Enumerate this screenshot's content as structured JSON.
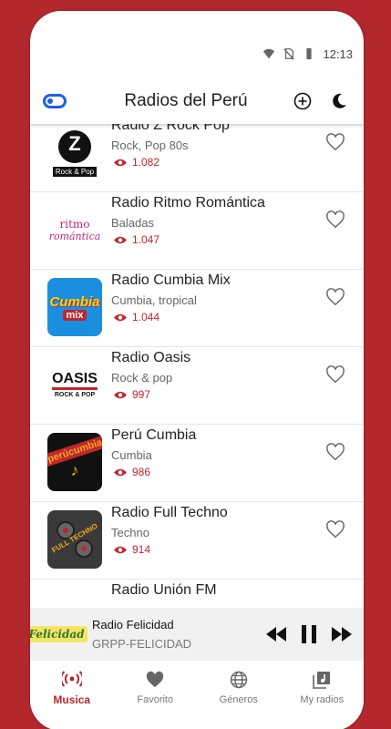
{
  "status": {
    "time": "12:13"
  },
  "appbar": {
    "title": "Radios del Perú"
  },
  "stations": [
    {
      "name": "Radio Z Rock Pop",
      "genre": " Rock, Pop 80s",
      "views": "1.082",
      "logo_text": "Z",
      "logo_sub": "Rock & Pop"
    },
    {
      "name": "Radio Ritmo Romántica",
      "genre": "Baladas",
      "views": "1.047",
      "logo_text": "ritmo",
      "logo_sub": "romántica"
    },
    {
      "name": "Radio Cumbia Mix",
      "genre": "Cumbia, tropical",
      "views": "1.044",
      "logo_text": "Cumbia",
      "logo_sub": "mix"
    },
    {
      "name": "Radio Oasis",
      "genre": "Rock & pop",
      "views": "997",
      "logo_text": "OASIS",
      "logo_sub": "ROCK & POP"
    },
    {
      "name": " Perú Cumbia",
      "genre": "Cumbia",
      "views": "986",
      "logo_text": "perúcumbia",
      "logo_sub": ""
    },
    {
      "name": "Radio Full Techno",
      "genre": "Techno",
      "views": "914",
      "logo_text": "FULL TECHNO",
      "logo_sub": ""
    },
    {
      "name": "Radio Unión FM",
      "genre": "",
      "views": "",
      "logo_text": "",
      "logo_sub": ""
    }
  ],
  "player": {
    "title": "Radio Felicidad",
    "subtitle": "GRPP-FELICIDAD",
    "logo_text": "Felicidad"
  },
  "nav": [
    {
      "label": "Musica",
      "icon": "radio-icon",
      "active": true
    },
    {
      "label": "Favorito",
      "icon": "heart-icon",
      "active": false
    },
    {
      "label": "Géneros",
      "icon": "globe-icon",
      "active": false
    },
    {
      "label": "My radios",
      "icon": "music-library-icon",
      "active": false
    }
  ],
  "colors": {
    "brand": "#b3282d",
    "accent": "#1e5ee8",
    "views": "#c0262c"
  }
}
